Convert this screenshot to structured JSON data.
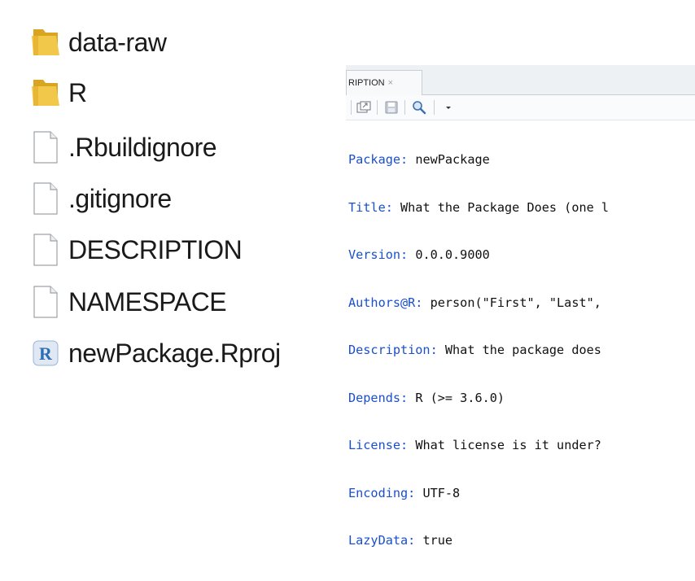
{
  "explorer": {
    "items": [
      {
        "name": "data-raw",
        "kind": "folder"
      },
      {
        "name": "R",
        "kind": "folder"
      },
      {
        "name": ".Rbuildignore",
        "kind": "file"
      },
      {
        "name": ".gitignore",
        "kind": "file"
      },
      {
        "name": "DESCRIPTION",
        "kind": "file"
      },
      {
        "name": "NAMESPACE",
        "kind": "file"
      },
      {
        "name": "newPackage.Rproj",
        "kind": "rproj",
        "badge": "R"
      }
    ]
  },
  "editor": {
    "tab_label": "RIPTION",
    "tab_close": "×",
    "code_lines": [
      {
        "key": "Package",
        "sep": ":",
        "value": " newPackage"
      },
      {
        "key": "Title",
        "sep": ":",
        "value": " What the Package Does (one l"
      },
      {
        "key": "Version",
        "sep": ":",
        "value": " 0.0.0.9000"
      },
      {
        "key": "Authors@R",
        "sep": ":",
        "value": " person(\"First\", \"Last\","
      },
      {
        "key": "Description",
        "sep": ":",
        "value": " What the package does"
      },
      {
        "key": "Depends",
        "sep": ":",
        "value": " R (>= 3.6.0)"
      },
      {
        "key": "License",
        "sep": ":",
        "value": " What license is it under?"
      },
      {
        "key": "Encoding",
        "sep": ":",
        "value": " UTF-8"
      },
      {
        "key": "LazyData",
        "sep": ":",
        "value": " true"
      }
    ]
  },
  "colors": {
    "folder": "#f2c84b",
    "folder_dark": "#d9a520",
    "keyword": "#1a4fcf",
    "rproj_badge": "#2f6db5"
  },
  "icons": {
    "toolbar": [
      "open-in-window-icon",
      "save-icon",
      "search-icon",
      "dropdown-icon"
    ]
  }
}
